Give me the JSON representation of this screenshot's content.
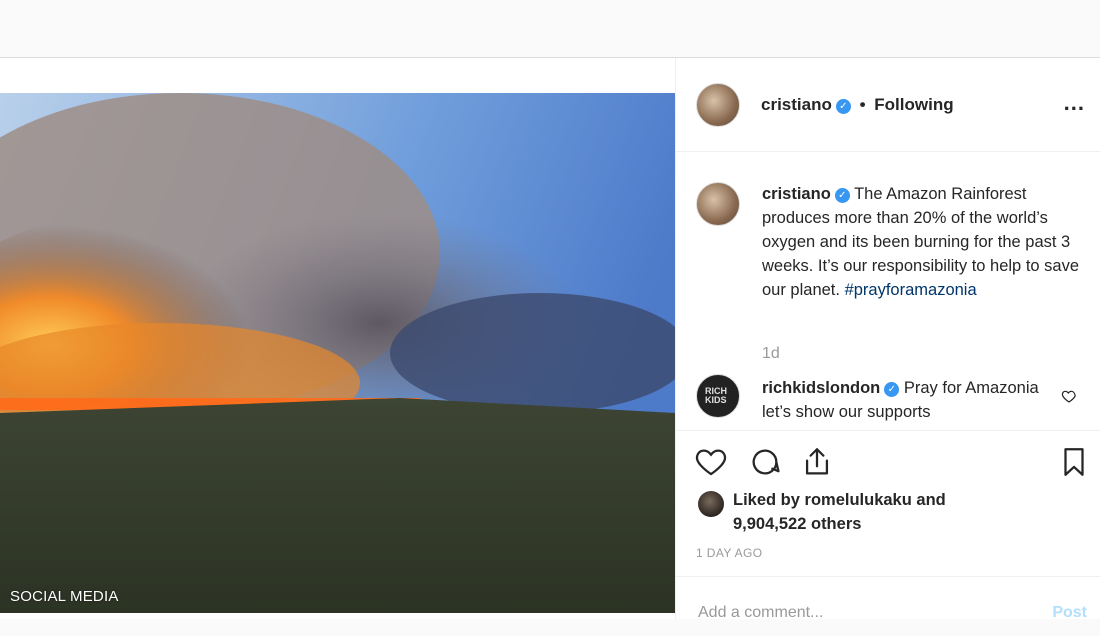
{
  "post": {
    "image_alt": "Wildfire smoke over the Amazon",
    "watermark": "SOCIAL MEDIA"
  },
  "header": {
    "username": "cristiano",
    "verified_icon": "verified-badge-icon",
    "separator": "•",
    "follow_status": "Following",
    "more_label": "..."
  },
  "caption": {
    "username": "cristiano",
    "text": "The Amazon Rainforest produces more than 20% of the world’s oxygen and its been burning for the past 3 weeks. It’s our responsibility to help to save our planet.",
    "hashtag": "#prayforamazonia",
    "time": "1d"
  },
  "comments": [
    {
      "username": "richkidslondon",
      "text": "Pray for Amazonia let’s show our supports",
      "avatar_text": "RICH KIDS"
    }
  ],
  "actions": {
    "like_icon": "heart-icon",
    "comment_icon": "comment-icon",
    "share_icon": "share-icon",
    "save_icon": "bookmark-icon"
  },
  "likes": {
    "prefix": "Liked by",
    "user": "romelulukaku",
    "conj": "and",
    "count": "9,904,522 others"
  },
  "posted": "1 DAY AGO",
  "add_comment": {
    "placeholder": "Add a comment...",
    "post_label": "Post"
  },
  "colors": {
    "link": "#003569",
    "verified": "#3897f0",
    "muted": "#999999",
    "post_button": "#b2dffc",
    "border": "#efefef"
  }
}
